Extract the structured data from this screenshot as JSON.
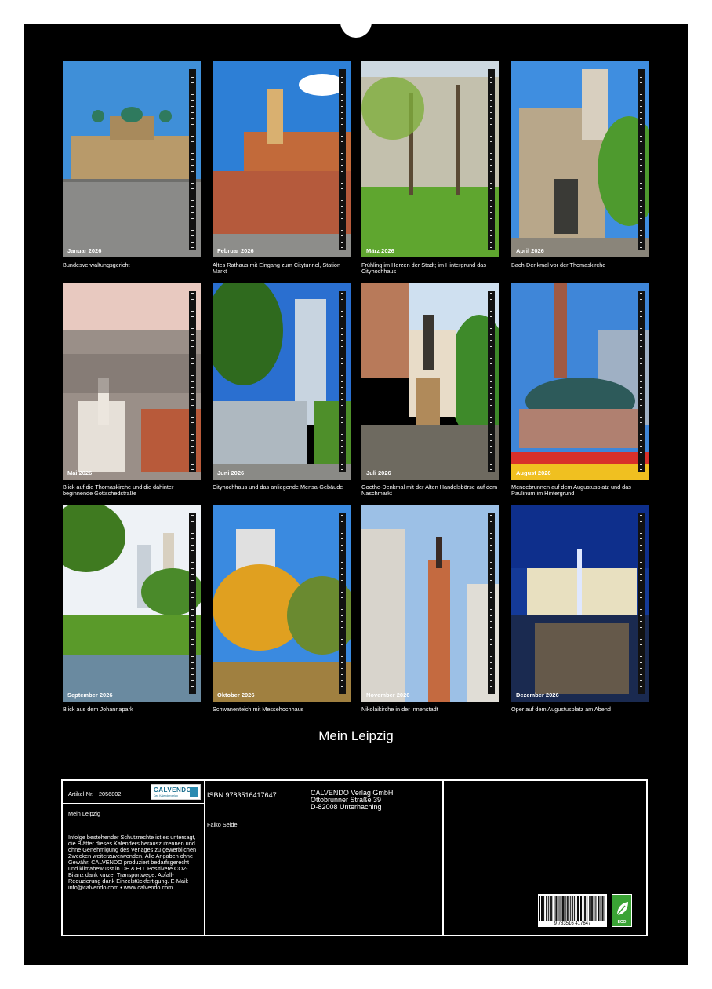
{
  "calendar_title": "Mein Leipzig",
  "months": [
    {
      "label": "Januar 2026",
      "caption": "Bundesverwaltungsgericht"
    },
    {
      "label": "Februar 2026",
      "caption": "Altes Rathaus mit Eingang zum Citytunnel, Station Markt"
    },
    {
      "label": "März 2026",
      "caption": "Frühling im Herzen der Stadt; im Hintergrund das Cityhochhaus"
    },
    {
      "label": "April 2026",
      "caption": "Bach-Denkmal vor der Thomaskirche"
    },
    {
      "label": "Mai 2026",
      "caption": "Blick auf die Thomaskirche und die dahinter beginnende Gottschedstraße"
    },
    {
      "label": "Juni 2026",
      "caption": "Cityhochhaus und das anliegende Mensa-Gebäude"
    },
    {
      "label": "Juli 2026",
      "caption": "Goethe-Denkmal mit der Alten Handelsbörse auf dem Naschmarkt"
    },
    {
      "label": "August 2026",
      "caption": "Mendebrunnen auf dem Augustusplatz und das Paulinum im Hintergrund"
    },
    {
      "label": "September 2026",
      "caption": "Blick aus dem Johannapark"
    },
    {
      "label": "Oktober 2026",
      "caption": "Schwanenteich mit Messehochhaus"
    },
    {
      "label": "November 2026",
      "caption": "Nikolaikirche in der Innenstadt"
    },
    {
      "label": "Dezember 2026",
      "caption": "Oper auf dem Augustusplatz am Abend"
    }
  ],
  "info": {
    "article_label": "Artikel-Nr.",
    "article_number": "2056802",
    "logo_text": "CALVENDO",
    "logo_sub": "Das Kalenderverlag",
    "product_title": "Mein Leipzig",
    "legal_text": "Infolge bestehender Schutzrechte ist es untersagt, die Blätter dieses Kalenders herauszutrennen und ohne Genehmigung des Verlages zu gewerblichen Zwecken weiterzuverwenden. Alle Angaben ohne Gewähr. CALVENDO produziert bedarfsgerecht und klimabewusst in DE & EU. Positivere CO2-Bilanz dank kurzer Transportwege. Abfall-Reduzierung dank Einzelstückfertigung. E-Mail: info@calvendo.com • www.calvendo.com",
    "isbn": "ISBN 9783516417647",
    "author": "Falko Seidel",
    "publisher_line1": "CALVENDO Verlag GmbH",
    "publisher_line2": "Ottobrunner Straße 39",
    "publisher_line3": "D-82008 Unterhaching",
    "barcode_digits": "9 783516 417647",
    "eco_label": "ECO"
  }
}
